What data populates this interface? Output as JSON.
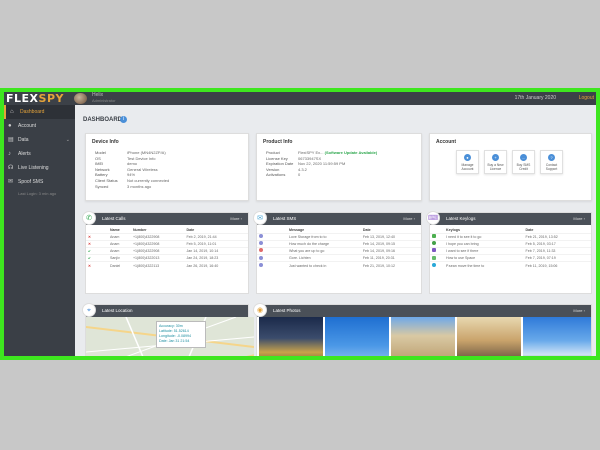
{
  "app": {
    "logo_a": "FLEX",
    "logo_b": "SPY"
  },
  "topbar": {
    "user_name": "Helix",
    "user_sub": "Administrator",
    "date": "17th January 2020",
    "logout": "Logout"
  },
  "sidebar": {
    "items": [
      {
        "label": "Dashboard",
        "icon": "home-icon",
        "active": true
      },
      {
        "label": "Account",
        "icon": "user-icon"
      },
      {
        "label": "Data",
        "icon": "data-icon",
        "has_chevron": true
      },
      {
        "label": "Alerts",
        "icon": "bell-icon"
      },
      {
        "label": "Live Listening",
        "icon": "headphones-icon"
      },
      {
        "label": "Spoof SMS",
        "icon": "message-icon"
      }
    ],
    "note": "Last Login: 3 min ago"
  },
  "dashboard": {
    "title": "DASHBOARD",
    "info": "i"
  },
  "device_info": {
    "title": "Device Info",
    "rows": [
      {
        "k": "Model",
        "v": "iPhone (MN4N2ZP/A)"
      },
      {
        "k": "OS",
        "v": "Test Device Info"
      },
      {
        "k": "IMEI",
        "v": "demo"
      },
      {
        "k": "Network",
        "v": "General Wireless"
      },
      {
        "k": "Battery",
        "v": "94%"
      },
      {
        "k": "Client Status",
        "v": "Not currently connected"
      },
      {
        "k": "Synced",
        "v": "3 months ago"
      }
    ]
  },
  "product_info": {
    "title": "Product Info",
    "rows": [
      {
        "k": "Product",
        "v": "FlexiSPY Ex...",
        "badge": "(Software Update Available)"
      },
      {
        "k": "License Key",
        "v": "06733947SX"
      },
      {
        "k": "Expiration Date",
        "v": "Nov 22, 2020 11:59:59 PM"
      },
      {
        "k": "Version",
        "v": "4.3.2"
      },
      {
        "k": "Activations",
        "v": "0"
      }
    ]
  },
  "account": {
    "title": "Account",
    "buttons": [
      {
        "label": "Manage Account",
        "icon": "user-icon"
      },
      {
        "label": "Buy a New Licence",
        "icon": "cart-icon"
      },
      {
        "label": "Buy SMS Credit",
        "icon": "chat-icon"
      },
      {
        "label": "Contact Support",
        "icon": "support-icon"
      }
    ]
  },
  "latest_calls": {
    "title": "Latest Calls",
    "more": "More",
    "headers": [
      "",
      "Name",
      "Number",
      "Date"
    ],
    "rows": [
      {
        "type": "x",
        "name": "Anam",
        "number": "+1(800)4322908",
        "date": "Feb 2, 2019, 21:44"
      },
      {
        "type": "x",
        "name": "Anam",
        "number": "+1(800)4322908",
        "date": "Feb 5, 2019, 11:01"
      },
      {
        "type": "ok",
        "name": "Anam",
        "number": "+1(800)4322908",
        "date": "Jan 14, 2019, 10:14"
      },
      {
        "type": "ok",
        "name": "Sanjiv",
        "number": "+1(800)4322013",
        "date": "Jan 24, 2019, 18:23"
      },
      {
        "type": "x",
        "name": "Daniel",
        "number": "+1(800)4322113",
        "date": "Jan 26, 2019, 16:40"
      }
    ]
  },
  "latest_sms": {
    "title": "Latest SMS",
    "more": "More",
    "headers": [
      "",
      "Message",
      "Date"
    ],
    "rows": [
      {
        "msg": "Love Storage from to to",
        "date": "Feb 13, 2019, 12:40"
      },
      {
        "msg": "How much do the charge",
        "date": "Feb 14, 2019, 09:15"
      },
      {
        "msg": "What you are up to go",
        "date": "Feb 14, 2019, 09:16"
      },
      {
        "msg": "Gore. Lichten",
        "date": "Feb 11, 2019, 20:31"
      },
      {
        "msg": "Just wanted to check in",
        "date": "Feb 21, 2019, 10:12"
      }
    ]
  },
  "latest_keylogs": {
    "title": "Latest Keylogs",
    "more": "More",
    "headers": [
      "",
      "Keylogs",
      "Date"
    ],
    "rows": [
      {
        "k": "I need it to see it to go",
        "date": "Feb 21, 2019, 13:52"
      },
      {
        "k": "I hope you can bring",
        "date": "Feb 5, 2019, 03:17"
      },
      {
        "k": "I want to see if there",
        "date": "Feb 7, 2019, 11:33"
      },
      {
        "k": "How to use Space",
        "date": "Feb 7, 2019, 07:19"
      },
      {
        "k": "P.sean move the time to",
        "date": "Feb 11, 2019, 15:06"
      }
    ]
  },
  "latest_location": {
    "title": "Latest Location",
    "more": "",
    "popup": [
      "Accuracy: 30m",
      "Latitude: 51.52614",
      "Longitude: -0.08994",
      "Date: Jan 31 21:54"
    ]
  },
  "latest_photos": {
    "title": "Latest Photos",
    "more": "More"
  }
}
